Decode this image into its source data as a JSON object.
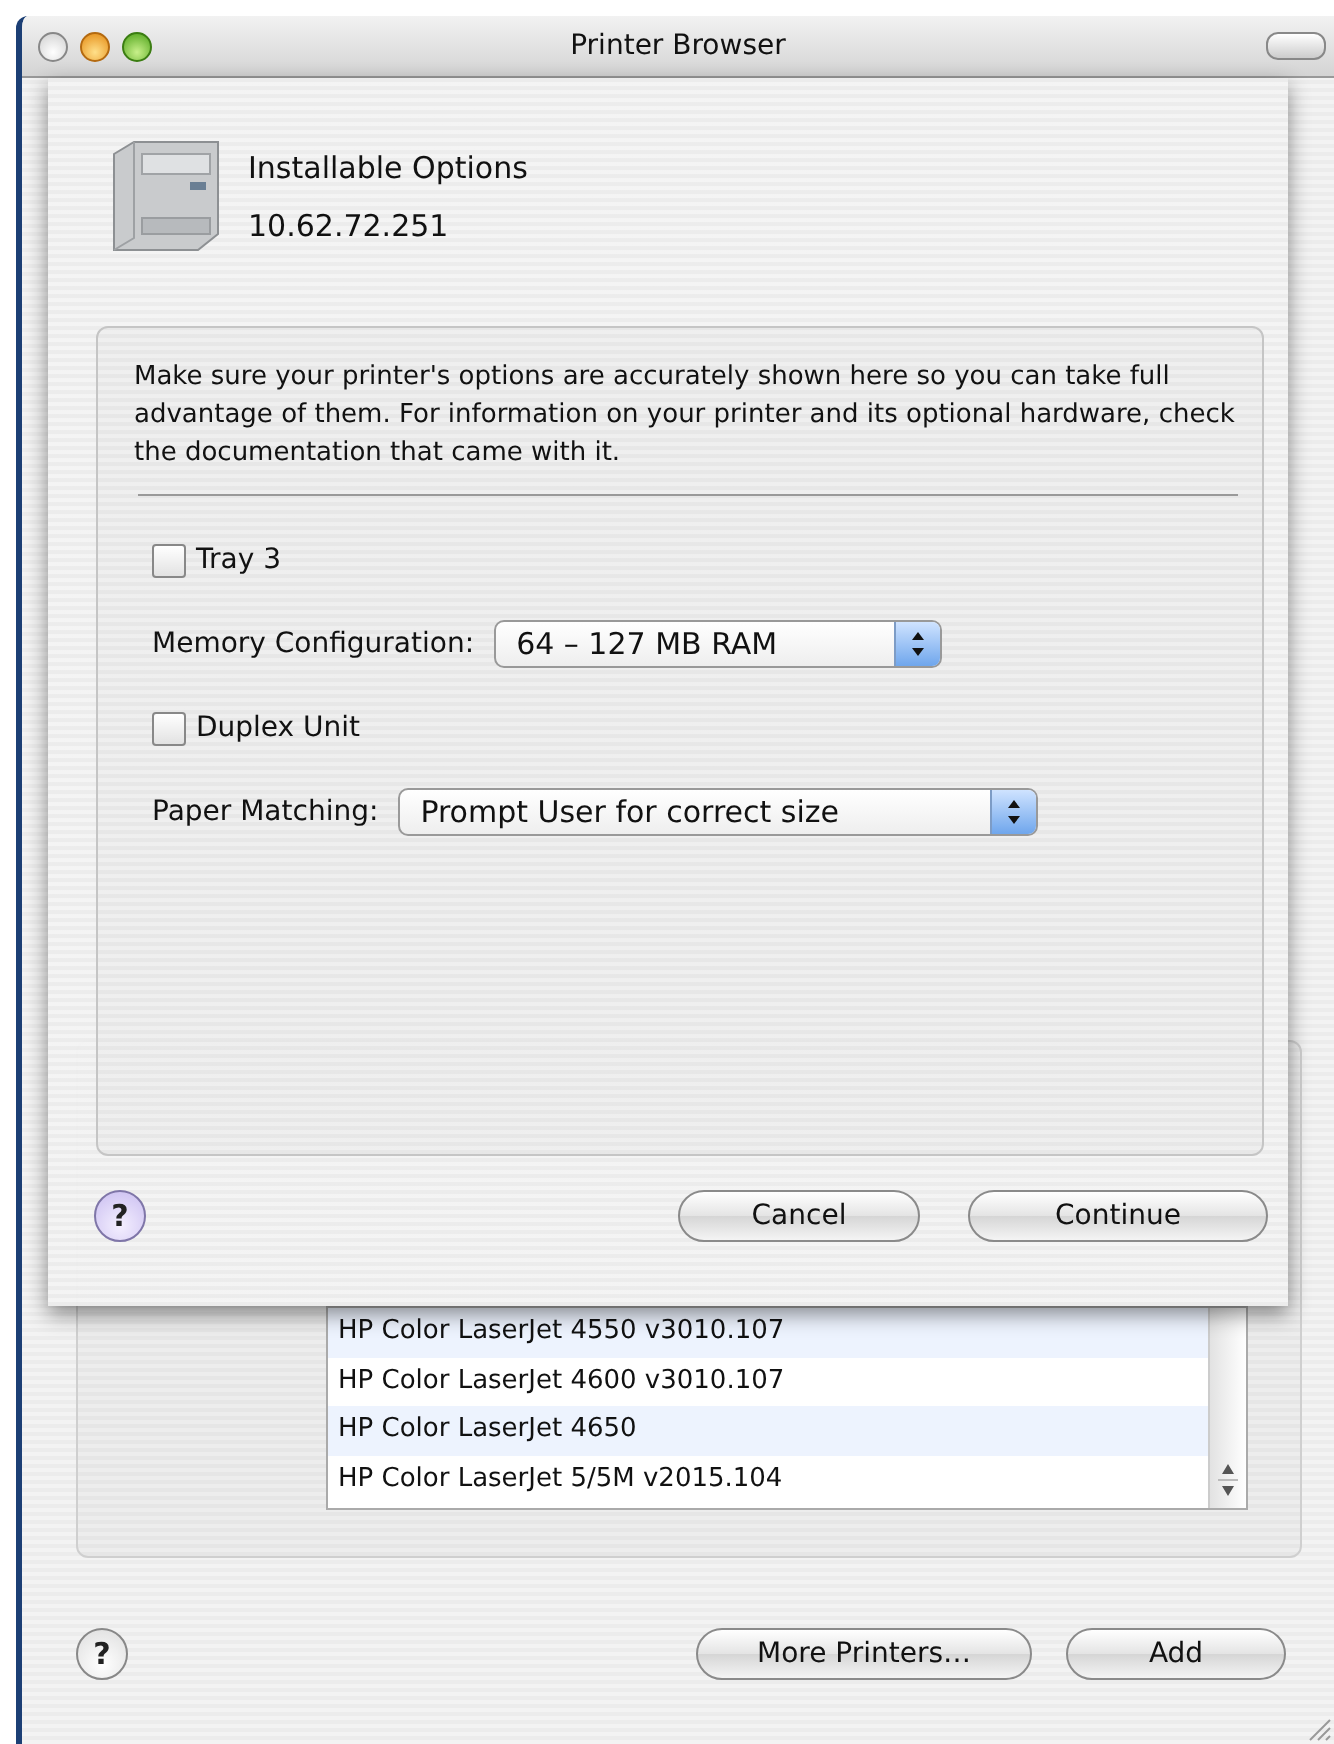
{
  "window": {
    "title": "Printer Browser"
  },
  "sheet": {
    "title": "Installable Options",
    "subtitle": "10.62.72.251",
    "description": "Make sure your printer's options are accurately shown here so you can take full advantage of them. For information on your printer and its optional hardware, check the documentation that came with it.",
    "options": [
      {
        "kind": "checkbox",
        "label": "Tray 3",
        "checked": false
      },
      {
        "kind": "popup",
        "label": "Memory Configuration:",
        "value": "64 – 127 MB RAM"
      },
      {
        "kind": "checkbox",
        "label": "Duplex Unit",
        "checked": false
      },
      {
        "kind": "popup",
        "label": "Paper Matching:",
        "value": "Prompt User for correct size"
      }
    ],
    "help_button": "?",
    "buttons": [
      "Cancel",
      "Continue"
    ]
  },
  "help_button": "?",
  "printer_list": {
    "rows": [
      "HP Color LaserJet 4550 v3010.107",
      "HP Color LaserJet 4600 v3010.107",
      "HP Color LaserJet 4650",
      "HP Color LaserJet 5/5M v2015.104"
    ]
  },
  "buttons": [
    "More Printers…",
    "Add"
  ]
}
